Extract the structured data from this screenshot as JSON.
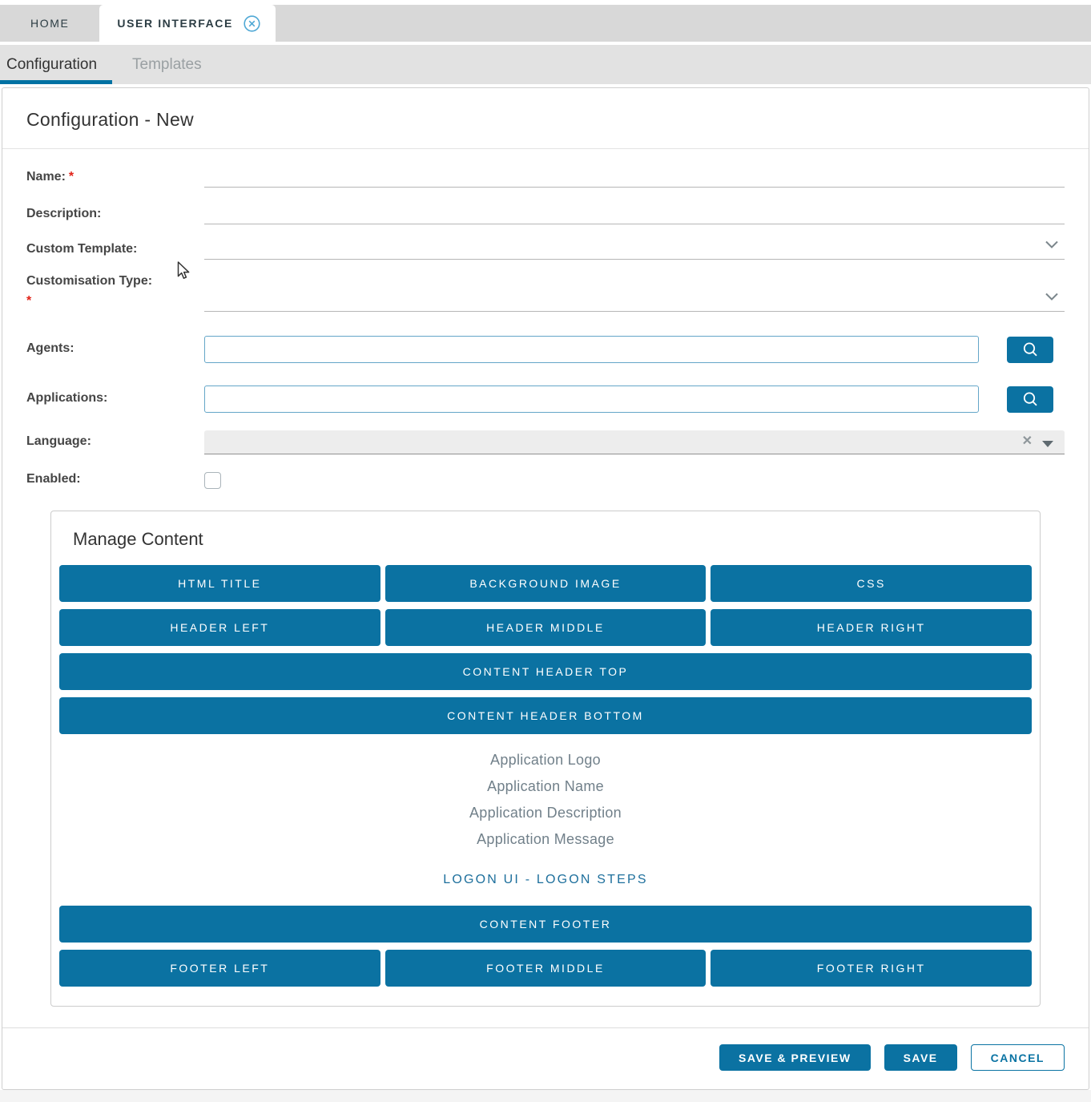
{
  "header_tabs": {
    "home": "HOME",
    "user_interface": "USER INTERFACE"
  },
  "subtabs": {
    "configuration": "Configuration",
    "templates": "Templates"
  },
  "panel": {
    "title": "Configuration - New"
  },
  "form": {
    "name_label": "Name:",
    "name_value": "",
    "description_label": "Description:",
    "description_value": "",
    "custom_template_label": "Custom Template:",
    "custom_template_value": "",
    "customisation_type_label": "Customisation Type:",
    "customisation_type_value": "",
    "agents_label": "Agents:",
    "agents_value": "",
    "applications_label": "Applications:",
    "applications_value": "",
    "language_label": "Language:",
    "language_value": "",
    "enabled_label": "Enabled:",
    "enabled_checked": false,
    "required_marker": "*"
  },
  "manage_content": {
    "title": "Manage Content",
    "buttons": {
      "html_title": "HTML TITLE",
      "background_image": "BACKGROUND IMAGE",
      "css": "CSS",
      "header_left": "HEADER LEFT",
      "header_middle": "HEADER MIDDLE",
      "header_right": "HEADER RIGHT",
      "content_header_top": "CONTENT HEADER TOP",
      "content_header_bottom": "CONTENT HEADER BOTTOM",
      "content_footer": "CONTENT FOOTER",
      "footer_left": "FOOTER LEFT",
      "footer_middle": "FOOTER MIDDLE",
      "footer_right": "FOOTER RIGHT"
    },
    "links": {
      "application_logo": "Application Logo",
      "application_name": "Application Name",
      "application_description": "Application Description",
      "application_message": "Application Message",
      "logon_ui": "LOGON UI - LOGON STEPS"
    }
  },
  "footer_actions": {
    "save_preview": "SAVE & PREVIEW",
    "save": "SAVE",
    "cancel": "CANCEL"
  },
  "colors": {
    "primary_blue": "#0b72a2",
    "tab_underline_blue": "#0072a3",
    "link_blue": "#1d6f9c",
    "required_red": "#e12218"
  }
}
